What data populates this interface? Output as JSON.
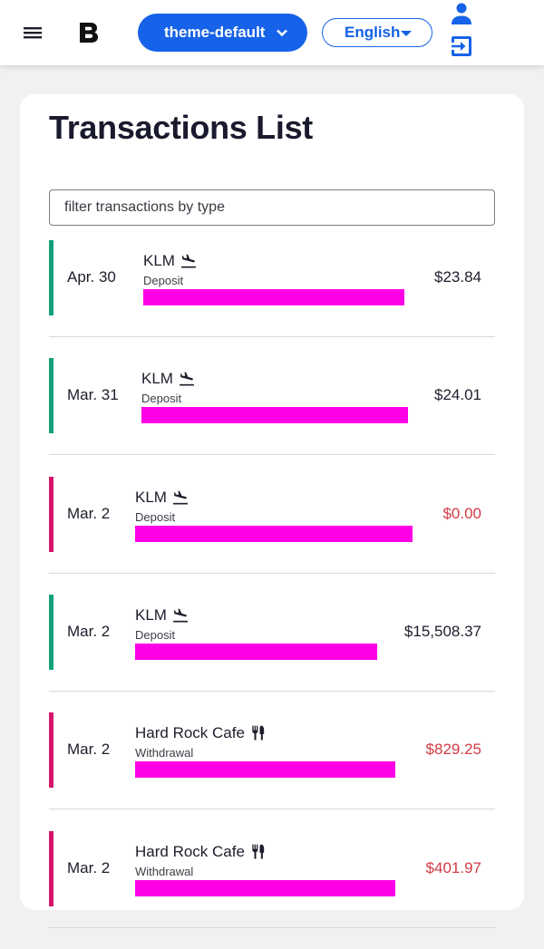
{
  "header": {
    "menu_icon": "hamburger-menu-icon",
    "logo_icon": "bold-b-logo-icon",
    "theme_label": "theme-default",
    "language_label": "English",
    "user_icon": "person-icon",
    "logout_icon": "logout-icon"
  },
  "page": {
    "title": "Transactions List",
    "filter_placeholder": "filter transactions by type"
  },
  "colors": {
    "primary": "#1662e8",
    "deposit_accent": "#12a07a",
    "withdrawal_accent": "#d6146c",
    "negative_amount": "#d23b44",
    "bar": "#ff00e6"
  },
  "transactions": [
    {
      "date": "Apr. 30",
      "merchant": "KLM",
      "icon": "airplane-landing-icon",
      "type": "Deposit",
      "amount": "$23.84",
      "bar_fraction": 0.995,
      "accent": "deposit",
      "amount_negative": false
    },
    {
      "date": "Mar. 31",
      "merchant": "KLM",
      "icon": "airplane-landing-icon",
      "type": "Deposit",
      "amount": "$24.01",
      "bar_fraction": 1.0,
      "accent": "deposit",
      "amount_negative": false
    },
    {
      "date": "Mar. 2",
      "merchant": "KLM",
      "icon": "airplane-landing-icon",
      "type": "Deposit",
      "amount": "$0.00",
      "bar_fraction": 1.0,
      "accent": "withdrawal",
      "amount_negative": true
    },
    {
      "date": "Mar. 2",
      "merchant": "KLM",
      "icon": "airplane-landing-icon",
      "type": "Deposit",
      "amount": "$15,508.37",
      "bar_fraction": 1.0,
      "accent": "deposit",
      "amount_negative": false
    },
    {
      "date": "Mar. 2",
      "merchant": "Hard Rock Cafe",
      "icon": "restaurant-utensils-icon",
      "type": "Withdrawal",
      "amount": "$829.25",
      "bar_fraction": 1.0,
      "accent": "withdrawal",
      "amount_negative": true
    },
    {
      "date": "Mar. 2",
      "merchant": "Hard Rock Cafe",
      "icon": "restaurant-utensils-icon",
      "type": "Withdrawal",
      "amount": "$401.97",
      "bar_fraction": 1.0,
      "accent": "withdrawal",
      "amount_negative": true
    }
  ]
}
